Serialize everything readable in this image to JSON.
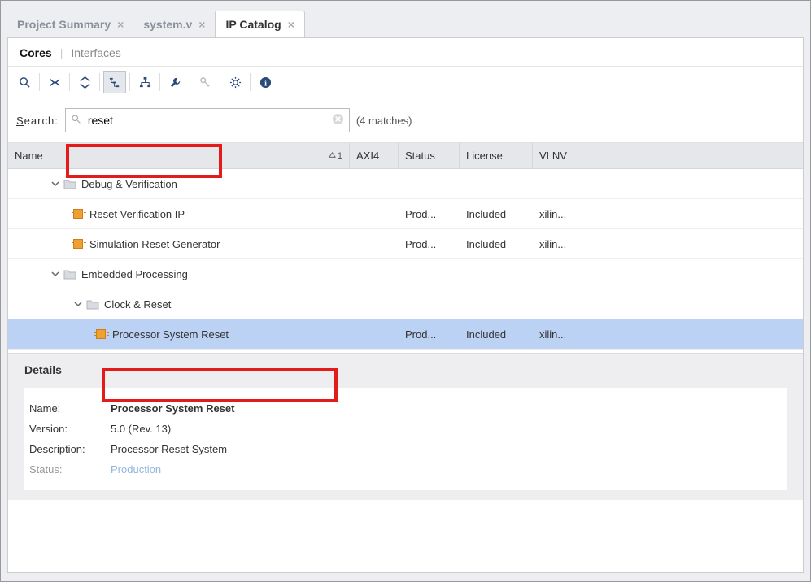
{
  "tabs": [
    {
      "label": "Project Summary",
      "active": false
    },
    {
      "label": "system.v",
      "active": false
    },
    {
      "label": "IP Catalog",
      "active": true
    }
  ],
  "subtabs": {
    "cores": "Cores",
    "interfaces": "Interfaces"
  },
  "search": {
    "label_pre": "S",
    "label_rest": "earch:",
    "value": "reset",
    "placeholder": "",
    "matches": "(4 matches)"
  },
  "columns": {
    "name": "Name",
    "axi": "AXI4",
    "status": "Status",
    "license": "License",
    "vlnv": "VLNV",
    "sort_indicator": "1"
  },
  "tree": [
    {
      "type": "cat",
      "indent": 1,
      "exp": "open",
      "label": "Debug & Verification"
    },
    {
      "type": "ip",
      "indent": 2,
      "label": "Reset Verification IP",
      "status": "Prod...",
      "license": "Included",
      "vlnv": "xilin..."
    },
    {
      "type": "ip",
      "indent": 2,
      "label": "Simulation Reset Generator",
      "status": "Prod...",
      "license": "Included",
      "vlnv": "xilin..."
    },
    {
      "type": "cat",
      "indent": 1,
      "exp": "open",
      "label": "Embedded Processing"
    },
    {
      "type": "cat",
      "indent": 2,
      "exp": "open",
      "label": "Clock & Reset"
    },
    {
      "type": "ip",
      "indent": 3,
      "label": "Processor System Reset",
      "status": "Prod...",
      "license": "Included",
      "vlnv": "xilin...",
      "selected": true
    }
  ],
  "details": {
    "header": "Details",
    "labels": {
      "name": "Name:",
      "version": "Version:",
      "desc": "Description:",
      "status": "Status:"
    },
    "name": "Processor System Reset",
    "version": "5.0 (Rev. 13)",
    "description": "Processor Reset System",
    "status": "Production"
  }
}
